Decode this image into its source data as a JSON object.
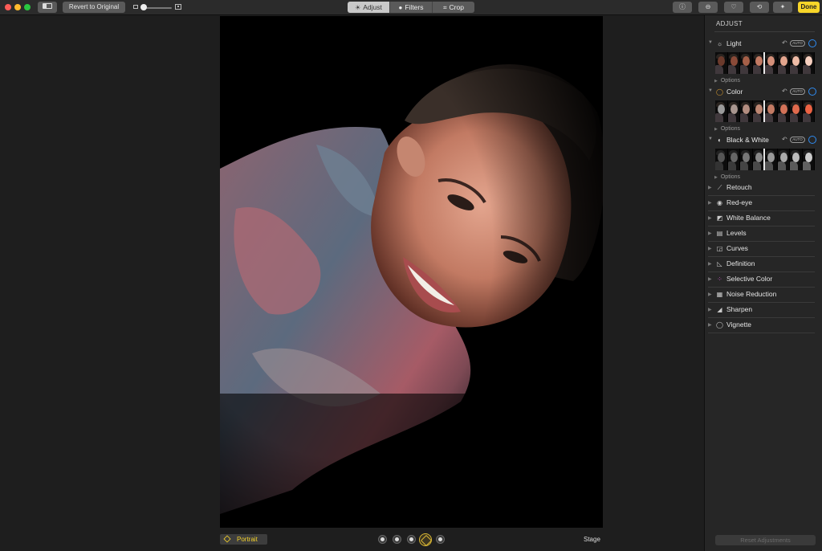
{
  "toolbar": {
    "revert_label": "Revert to Original",
    "zoom_level": 0.05,
    "tabs": [
      {
        "label": "Adjust",
        "icon": "adjust-icon",
        "active": true
      },
      {
        "label": "Filters",
        "icon": "filters-icon",
        "active": false
      },
      {
        "label": "Crop",
        "icon": "crop-icon",
        "active": false
      }
    ],
    "right_buttons": [
      "info-icon",
      "more-icon",
      "heart-icon",
      "rotate-icon",
      "magic-wand-icon"
    ],
    "done_label": "Done"
  },
  "canvas": {
    "portrait_label": "Portrait",
    "lighting_effect": "Stage",
    "lighting_options": [
      "natural-light",
      "studio-light",
      "contour-light",
      "stage-light",
      "stage-light-mono"
    ]
  },
  "sidebar": {
    "title": "ADJUST",
    "sections": [
      {
        "label": "Light",
        "auto_label": "AUTO",
        "options_label": "Options"
      },
      {
        "label": "Color",
        "auto_label": "AUTO",
        "options_label": "Options"
      },
      {
        "label": "Black & White",
        "auto_label": "AUTO",
        "options_label": "Options"
      }
    ],
    "adjustments": [
      {
        "label": "Retouch",
        "icon": "bandage-icon"
      },
      {
        "label": "Red-eye",
        "icon": "eye-icon"
      },
      {
        "label": "White Balance",
        "icon": "white-balance-icon"
      },
      {
        "label": "Levels",
        "icon": "levels-icon"
      },
      {
        "label": "Curves",
        "icon": "curves-icon"
      },
      {
        "label": "Definition",
        "icon": "definition-icon"
      },
      {
        "label": "Selective Color",
        "icon": "selective-color-icon"
      },
      {
        "label": "Noise Reduction",
        "icon": "noise-reduction-icon"
      },
      {
        "label": "Sharpen",
        "icon": "sharpen-icon"
      },
      {
        "label": "Vignette",
        "icon": "vignette-icon"
      }
    ],
    "reset_label": "Reset Adjustments"
  },
  "colors": {
    "accent_yellow": "#f8d629",
    "toggle_blue": "#2f8bf0",
    "background": "#1e1e1e",
    "sidebar": "#262626"
  }
}
